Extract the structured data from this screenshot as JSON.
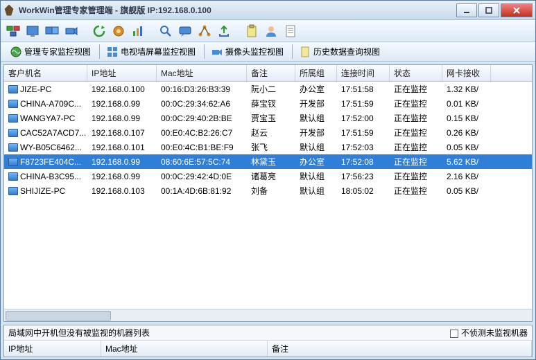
{
  "window": {
    "title": "WorkWin管理专家管理端 - 旗舰版 IP:192.168.0.100"
  },
  "tabs": [
    {
      "label": "管理专家监控视图"
    },
    {
      "label": "电视墙屏幕监控视图"
    },
    {
      "label": "摄像头监控视图"
    },
    {
      "label": "历史数据查询视图"
    }
  ],
  "table": {
    "headers": [
      "客户机名",
      "IP地址",
      "Mac地址",
      "备注",
      "所属组",
      "连接时间",
      "状态",
      "网卡接收"
    ],
    "rows": [
      {
        "name": "JIZE-PC",
        "ip": "192.168.0.100",
        "mac": "00:16:D3:26:B3:39",
        "remark": "阮小二",
        "group": "办公室",
        "time": "17:51:58",
        "status": "正在监控",
        "net": "1.32 KB/",
        "sel": false
      },
      {
        "name": "CHINA-A709C...",
        "ip": "192.168.0.99",
        "mac": "00:0C:29:34:62:A6",
        "remark": "薛宝钗",
        "group": "开发部",
        "time": "17:51:59",
        "status": "正在监控",
        "net": "0.01 KB/",
        "sel": false
      },
      {
        "name": "WANGYA7-PC",
        "ip": "192.168.0.99",
        "mac": "00:0C:29:40:2B:BE",
        "remark": "贾宝玉",
        "group": "默认组",
        "time": "17:52:00",
        "status": "正在监控",
        "net": "0.15 KB/",
        "sel": false
      },
      {
        "name": "CAC52A7ACD7...",
        "ip": "192.168.0.107",
        "mac": "00:E0:4C:B2:26:C7",
        "remark": "赵云",
        "group": "开发部",
        "time": "17:51:59",
        "status": "正在监控",
        "net": "0.26 KB/",
        "sel": false
      },
      {
        "name": "WY-B05C6462...",
        "ip": "192.168.0.101",
        "mac": "00:E0:4C:B1:BE:F9",
        "remark": "张飞",
        "group": "默认组",
        "time": "17:52:03",
        "status": "正在监控",
        "net": "0.05 KB/",
        "sel": false
      },
      {
        "name": "F8723FE404C...",
        "ip": "192.168.0.99",
        "mac": "08:60:6E:57:5C:74",
        "remark": "林黛玉",
        "group": "办公室",
        "time": "17:52:08",
        "status": "正在监控",
        "net": "5.62 KB/",
        "sel": true
      },
      {
        "name": "CHINA-B3C95...",
        "ip": "192.168.0.99",
        "mac": "00:0C:29:42:4D:0E",
        "remark": "诸葛亮",
        "group": "默认组",
        "time": "17:56:23",
        "status": "正在监控",
        "net": "2.16 KB/",
        "sel": false
      },
      {
        "name": "SHIJIZE-PC",
        "ip": "192.168.0.103",
        "mac": "00:1A:4D:6B:81:92",
        "remark": "刘备",
        "group": "默认组",
        "time": "18:05:02",
        "status": "正在监控",
        "net": "0.05 KB/",
        "sel": false
      }
    ]
  },
  "bottom": {
    "title": "局域网中开机但没有被监视的机器列表",
    "checkbox_label": "不侦测未监视机器",
    "headers": [
      "IP地址",
      "Mac地址",
      "备注"
    ]
  }
}
